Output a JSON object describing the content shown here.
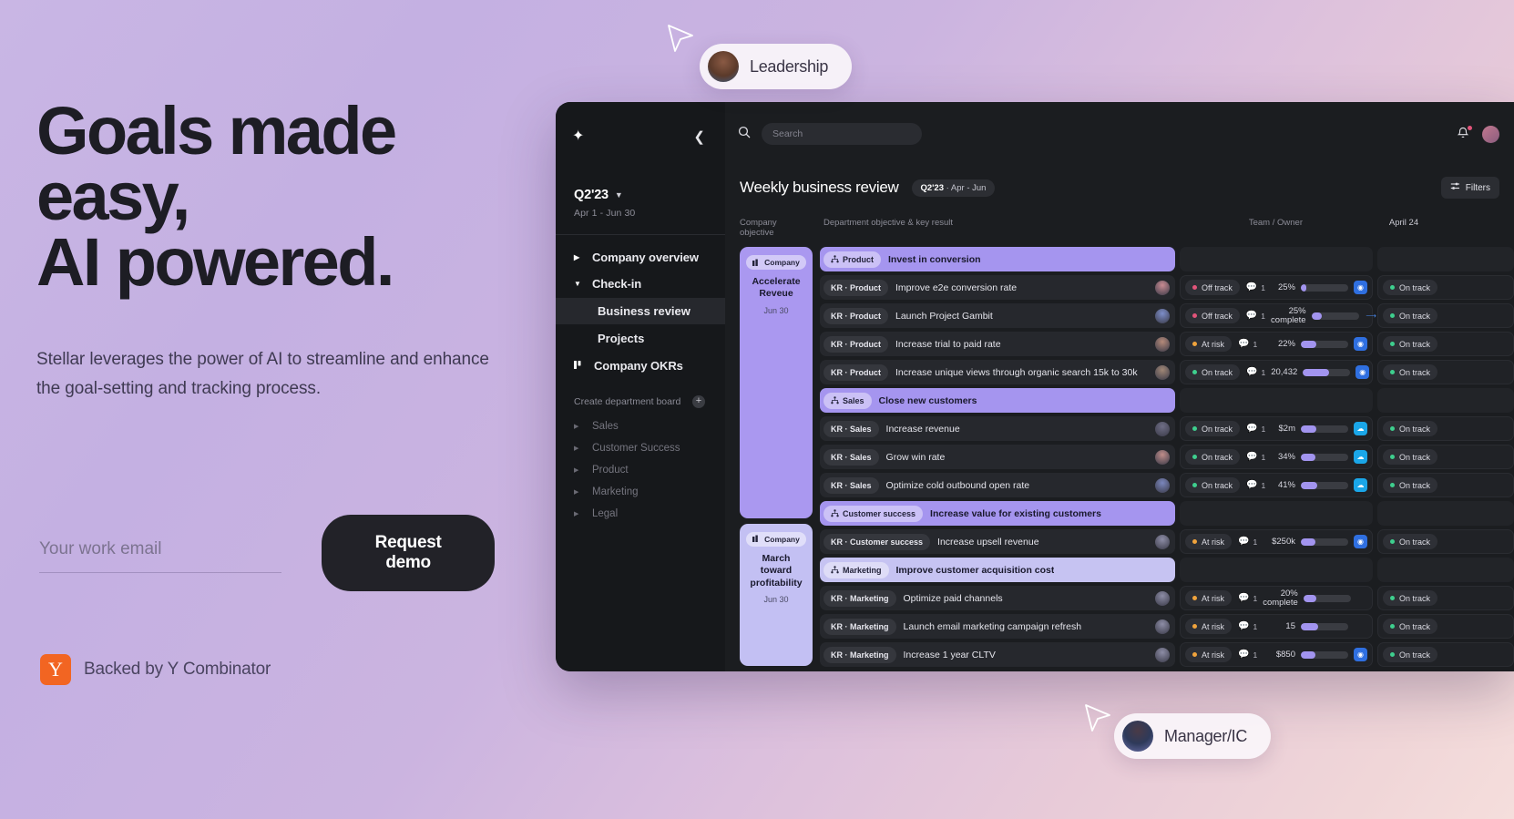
{
  "hero": {
    "line1": "Goals made",
    "line2": "easy,",
    "line3": "AI powered.",
    "subtitle": "Stellar leverages the power of AI to streamline and enhance the goal-setting and tracking process.",
    "email_placeholder": "Your work email",
    "email_value": "",
    "cta_label": "Request demo",
    "yc_logo_letter": "Y",
    "yc_text": "Backed by Y Combinator"
  },
  "badges": {
    "leadership": "Leadership",
    "manager": "Manager/IC"
  },
  "app": {
    "sidebar": {
      "logo_icon": "sparkle-icon",
      "collapse_icon": "chevron-left-icon",
      "quarter": "Q2'23",
      "quarter_range": "Apr 1 - Jun 30",
      "nav": [
        {
          "label": "Company overview",
          "icon": "triangle-right-icon",
          "type": "collapsed"
        },
        {
          "label": "Check-in",
          "icon": "triangle-down-icon",
          "type": "expanded"
        }
      ],
      "sub_items": [
        {
          "label": "Business review",
          "active": true
        },
        {
          "label": "Projects",
          "active": false
        }
      ],
      "okrs_label": "Company OKRs",
      "create_dept_label": "Create department board",
      "add_icon": "plus-icon",
      "departments": [
        {
          "label": "Sales"
        },
        {
          "label": "Customer Success"
        },
        {
          "label": "Product"
        },
        {
          "label": "Marketing"
        },
        {
          "label": "Legal"
        }
      ]
    },
    "topbar": {
      "search_placeholder": "Search",
      "search_value": "",
      "search_icon": "search-icon",
      "bell_icon": "bell-icon",
      "avatar_icon": "avatar"
    },
    "page": {
      "title": "Weekly business review",
      "pill_quarter": "Q2'23",
      "pill_range": "· Apr - Jun",
      "filters_label": "Filters",
      "filters_icon": "filter-icon"
    },
    "columns": {
      "company_objective": "Company objective",
      "department_objective": "Department objective & key result",
      "team_owner": "Team / Owner",
      "date": "April 24"
    },
    "objectives": [
      {
        "tag": "Company",
        "name": "Accelerate Reveue",
        "date": "Jun 30",
        "style": "c1"
      },
      {
        "tag": "Company",
        "name": "March toward profitability",
        "date": "Jun 30",
        "style": "c2"
      }
    ],
    "rows": [
      {
        "kind": "objective",
        "tone": "dark",
        "tag": "Product",
        "text": "Invest in conversion"
      },
      {
        "kind": "kr",
        "tag": "KR · Product",
        "text": "Improve e2e conversion rate",
        "avatar": "#c98b92",
        "status": "Off track",
        "status_color": "#e2547a",
        "comments": "1",
        "metric": "25%",
        "progress": 12,
        "source": "globe",
        "status2": "On track",
        "status2_color": "#3ecf8e"
      },
      {
        "kind": "kr",
        "tag": "KR · Product",
        "text": "Launch Project Gambit",
        "avatar": "#7d8ec9",
        "status": "Off track",
        "status_color": "#e2547a",
        "comments": "1",
        "metric": "25% complete",
        "progress": 22,
        "source": "arrows",
        "status2": "On track",
        "status2_color": "#3ecf8e"
      },
      {
        "kind": "kr",
        "tag": "KR · Product",
        "text": "Increase trial to paid rate",
        "avatar": "#b58a7a",
        "status": "At risk",
        "status_color": "#f0a33c",
        "comments": "1",
        "metric": "22%",
        "progress": 32,
        "source": "globe",
        "status2": "On track",
        "status2_color": "#3ecf8e"
      },
      {
        "kind": "kr",
        "tag": "KR · Product",
        "text": "Increase unique views through organic search 15k to 30k",
        "avatar": "#a08776",
        "status": "On track",
        "status_color": "#3ecf8e",
        "comments": "1",
        "metric": "20,432",
        "progress": 55,
        "source": "globe",
        "status2": "On track",
        "status2_color": "#3ecf8e"
      },
      {
        "kind": "objective",
        "tone": "dark",
        "tag": "Sales",
        "text": "Close new customers"
      },
      {
        "kind": "kr",
        "tag": "KR · Sales",
        "text": "Increase revenue",
        "avatar": "#6f6e86",
        "status": "On track",
        "status_color": "#3ecf8e",
        "comments": "1",
        "metric": "$2m",
        "progress": 32,
        "source": "cloud",
        "status2": "On track",
        "status2_color": "#3ecf8e"
      },
      {
        "kind": "kr",
        "tag": "KR · Sales",
        "text": "Grow win rate",
        "avatar": "#c08d8a",
        "status": "On track",
        "status_color": "#3ecf8e",
        "comments": "1",
        "metric": "34%",
        "progress": 30,
        "source": "cloud",
        "status2": "On track",
        "status2_color": "#3ecf8e"
      },
      {
        "kind": "kr",
        "tag": "KR · Sales",
        "text": "Optimize cold outbound open rate",
        "avatar": "#7b87bd",
        "status": "On track",
        "status_color": "#3ecf8e",
        "comments": "1",
        "metric": "41%",
        "progress": 35,
        "source": "cloud",
        "status2": "On track",
        "status2_color": "#3ecf8e"
      },
      {
        "kind": "objective",
        "tone": "dark",
        "tag": "Customer success",
        "text": "Increase value for existing customers"
      },
      {
        "kind": "kr",
        "tag": "KR · Customer success",
        "text": "Increase upsell revenue",
        "avatar": "#8d8da6",
        "status": "At risk",
        "status_color": "#f0a33c",
        "comments": "1",
        "metric": "$250k",
        "progress": 30,
        "source": "globe",
        "status2": "On track",
        "status2_color": "#3ecf8e"
      },
      {
        "kind": "objective",
        "tone": "light",
        "tag": "Marketing",
        "text": "Improve customer acquisition cost"
      },
      {
        "kind": "kr",
        "tag": "KR · Marketing",
        "text": "Optimize paid channels",
        "avatar": "#8d8da6",
        "status": "At risk",
        "status_color": "#f0a33c",
        "comments": "1",
        "metric": "20% complete",
        "progress": 28,
        "source": "",
        "status2": "On track",
        "status2_color": "#3ecf8e"
      },
      {
        "kind": "kr",
        "tag": "KR · Marketing",
        "text": "Launch email marketing campaign refresh",
        "avatar": "#8d8da6",
        "status": "At risk",
        "status_color": "#f0a33c",
        "comments": "1",
        "metric": "15",
        "progress": 36,
        "source": "",
        "status2": "On track",
        "status2_color": "#3ecf8e"
      },
      {
        "kind": "kr",
        "tag": "KR · Marketing",
        "text": "Increase  1 year CLTV",
        "avatar": "#8d8da6",
        "status": "At risk",
        "status_color": "#f0a33c",
        "comments": "1",
        "metric": "$850",
        "progress": 30,
        "source": "globe",
        "status2": "On track",
        "status2_color": "#3ecf8e"
      }
    ]
  }
}
